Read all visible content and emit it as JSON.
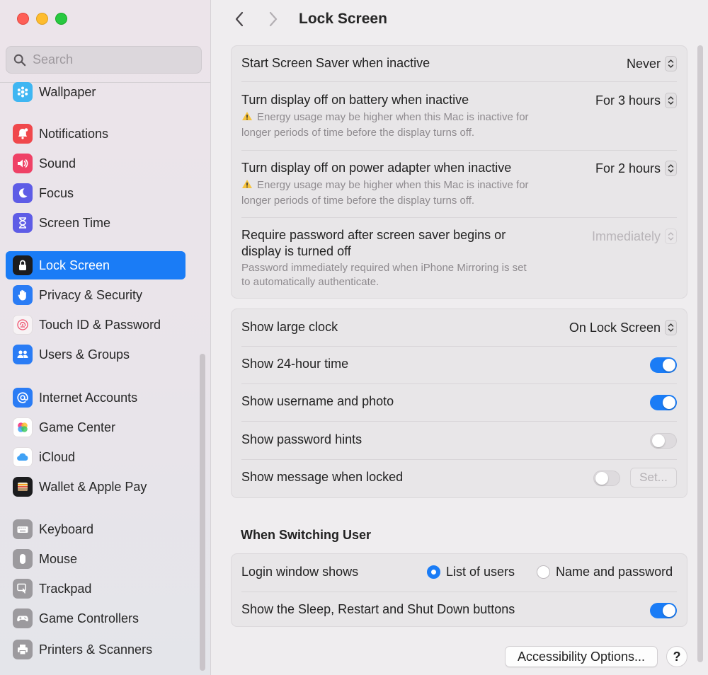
{
  "window": {
    "title": "Lock Screen"
  },
  "search": {
    "placeholder": "Search"
  },
  "sidebar": {
    "items": [
      {
        "label": "Wallpaper",
        "icon": "wallpaper-icon",
        "color": "#3fb6f2",
        "active": false
      },
      {
        "label": "Notifications",
        "icon": "notifications-icon",
        "color": "#f0484c",
        "active": false
      },
      {
        "label": "Sound",
        "icon": "sound-icon",
        "color": "#ef4166",
        "active": false
      },
      {
        "label": "Focus",
        "icon": "focus-icon",
        "color": "#5e5ce6",
        "active": false
      },
      {
        "label": "Screen Time",
        "icon": "screen-time-icon",
        "color": "#5e5ce6",
        "active": false
      },
      {
        "label": "Lock Screen",
        "icon": "lock-screen-icon",
        "color": "#1c1c1e",
        "active": true
      },
      {
        "label": "Privacy & Security",
        "icon": "privacy-hand-icon",
        "color": "#2a7cf5",
        "active": false
      },
      {
        "label": "Touch ID & Password",
        "icon": "fingerprint-icon",
        "color": "#f7f3f5",
        "active": false
      },
      {
        "label": "Users & Groups",
        "icon": "users-icon",
        "color": "#2a7cf5",
        "active": false
      },
      {
        "label": "Internet Accounts",
        "icon": "at-sign-icon",
        "color": "#2a7cf5",
        "active": false
      },
      {
        "label": "Game Center",
        "icon": "game-center-icon",
        "color": "#ffffff",
        "active": false
      },
      {
        "label": "iCloud",
        "icon": "cloud-icon",
        "color": "#ffffff",
        "active": false
      },
      {
        "label": "Wallet & Apple Pay",
        "icon": "wallet-icon",
        "color": "#1c1c1e",
        "active": false
      },
      {
        "label": "Keyboard",
        "icon": "keyboard-icon",
        "color": "#9c9a9e",
        "active": false
      },
      {
        "label": "Mouse",
        "icon": "mouse-icon",
        "color": "#9c9a9e",
        "active": false
      },
      {
        "label": "Trackpad",
        "icon": "trackpad-icon",
        "color": "#9c9a9e",
        "active": false
      },
      {
        "label": "Game Controllers",
        "icon": "game-controller-icon",
        "color": "#9c9a9e",
        "active": false
      },
      {
        "label": "Printers & Scanners",
        "icon": "printer-icon",
        "color": "#9c9a9e",
        "active": false
      }
    ]
  },
  "display": {
    "screensaver": {
      "label": "Start Screen Saver when inactive",
      "value": "Never"
    },
    "battery": {
      "label": "Turn display off on battery when inactive",
      "value": "For 3 hours",
      "note1": "Energy usage may be higher when this Mac is inactive for",
      "note2": "longer periods of time before the display turns off."
    },
    "adapter": {
      "label": "Turn display off on power adapter when inactive",
      "value": "For 2 hours",
      "note1": "Energy usage may be higher when this Mac is inactive for",
      "note2": "longer periods of time before the display turns off."
    },
    "password": {
      "label1": "Require password after screen saver begins or",
      "label2": "display is turned off",
      "value": "Immediately",
      "note1": "Password immediately required when iPhone Mirroring is set",
      "note2": "to automatically authenticate."
    }
  },
  "lock": {
    "clock": {
      "label": "Show large clock",
      "value": "On Lock Screen"
    },
    "time24": {
      "label": "Show 24-hour time",
      "on": true
    },
    "username": {
      "label": "Show username and photo",
      "on": true
    },
    "hints": {
      "label": "Show password hints",
      "on": false
    },
    "message": {
      "label": "Show message when locked",
      "on": false,
      "button": "Set..."
    }
  },
  "switching": {
    "title": "When Switching User",
    "login": {
      "label": "Login window shows",
      "option1": "List of users",
      "option2": "Name and password",
      "selected": "List of users"
    },
    "buttons": {
      "label": "Show the Sleep, Restart and Shut Down buttons",
      "on": true
    }
  },
  "footer": {
    "accessibility": "Accessibility Options...",
    "help": "?"
  },
  "colors": {
    "accent": "#1a7cf6"
  }
}
